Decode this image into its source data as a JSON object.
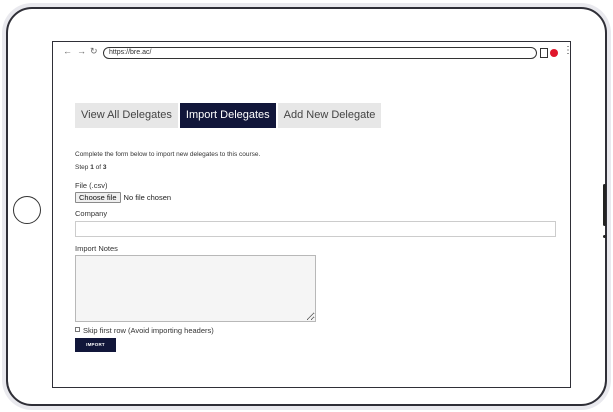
{
  "browser": {
    "back_icon": "arrow-left",
    "forward_icon": "arrow-right",
    "reload_icon": "reload",
    "url": "https://bre.ac/",
    "profile_color": "#e0162b"
  },
  "tabs": [
    {
      "label": "View All Delegates",
      "active": false
    },
    {
      "label": "Import Delegates",
      "active": true
    },
    {
      "label": "Add New Delegate",
      "active": false
    }
  ],
  "form": {
    "intro": "Complete the form below to import new delegates to this course.",
    "step_prefix": "Step ",
    "step_current": "1",
    "step_middle": " of ",
    "step_total": "3",
    "file_label": "File (.csv)",
    "choose_file_label": "Choose file",
    "no_file_text": "No file chosen",
    "company_label": "Company",
    "company_value": "",
    "notes_label": "Import Notes",
    "notes_value": "",
    "skip_label": "Skip first row (Avoid importing headers)",
    "skip_checked": false,
    "import_label": "IMPORT"
  },
  "colors": {
    "accent": "#11163a",
    "tab_inactive": "#e7e7e7"
  }
}
